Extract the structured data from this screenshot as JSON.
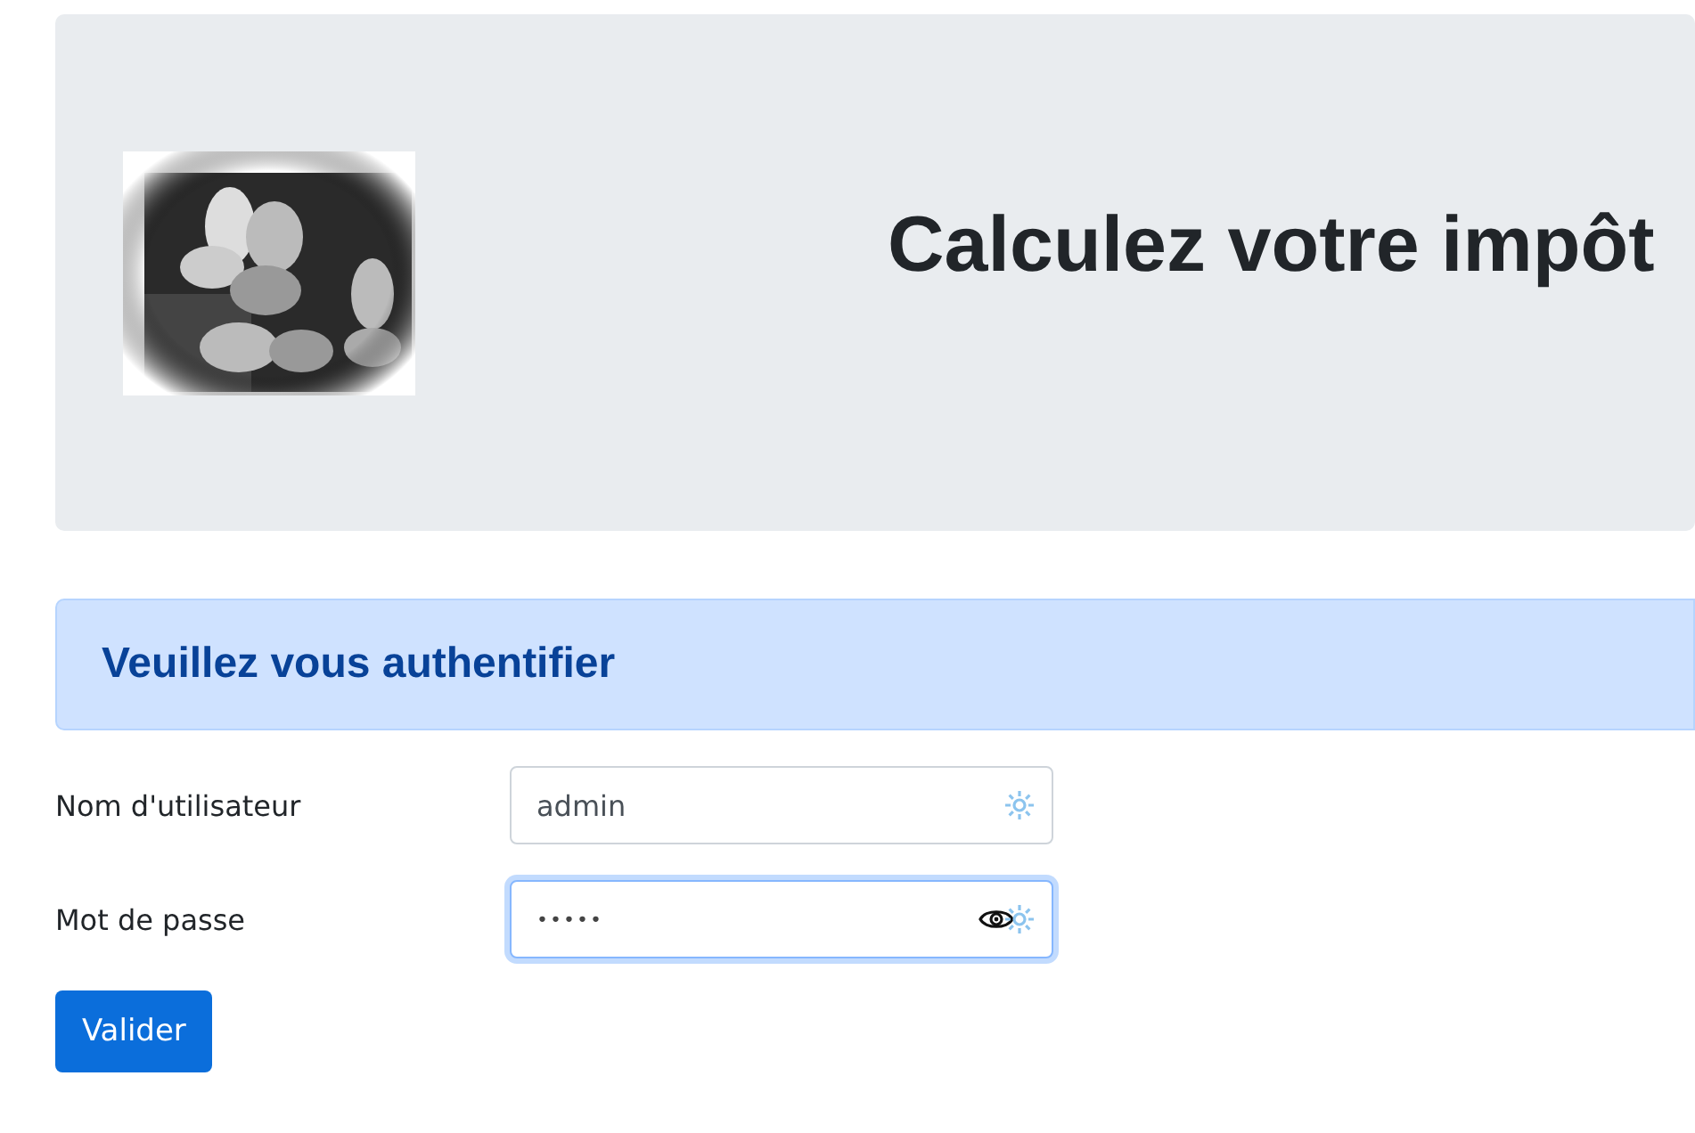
{
  "header": {
    "title": "Calculez votre impôt"
  },
  "alert": {
    "text": "Veuillez vous authentifier"
  },
  "fields": [
    {
      "label": "Nom d'utilisateur",
      "value": "admin",
      "kind": "text",
      "focused": false
    },
    {
      "label": "Mot de passe",
      "value": "•••••",
      "kind": "password",
      "focused": true
    }
  ],
  "submit": {
    "label": "Valider"
  }
}
